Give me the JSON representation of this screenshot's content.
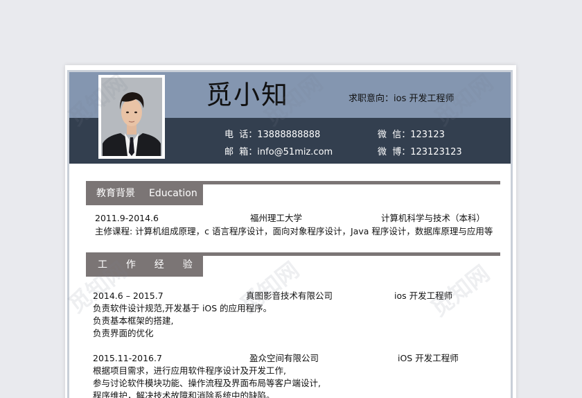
{
  "header": {
    "name": "觅小知",
    "intent_label": "求职意向：",
    "intent_value": "ios 开发工程师"
  },
  "contacts": {
    "phone_label": "电  话：",
    "phone": "13888888888",
    "wechat_label": "微  信：",
    "wechat": "123123",
    "email_label": "邮  箱：",
    "email": "info@51miz.com",
    "weibo_label": "微  博：",
    "weibo": "123123123"
  },
  "education": {
    "title_cn": "教育背景",
    "title_en": "Education",
    "period": "2011.9-2014.6",
    "school": "福州理工大学",
    "major": "计算机科学与技术（本科）",
    "courses": "主修课程: 计算机组成原理，c 语言程序设计，面向对象程序设计，Java 程序设计，数据库原理与应用等"
  },
  "work": {
    "title": "工  作  经  验",
    "jobs": [
      {
        "period": "2014.6  –  2015.7",
        "company": "真图影音技术有限公司",
        "position": "ios 开发工程师",
        "duties": [
          "负责软件设计规范,开发基于 iOS 的应用程序。",
          "负责基本框架的搭建,",
          "负责界面的优化"
        ]
      },
      {
        "period": "2015.11-2016.7",
        "company": "盈众空间有限公司",
        "position": "iOS 开发工程师",
        "duties": [
          "根据项目需求，进行应用软件程序设计及开发工作,",
          "参与讨论软件模块功能、操作流程及界面布局等客户端设计,",
          "程序维护，解决技术故障和消除系统中的缺陷。"
        ]
      }
    ]
  },
  "watermark": "觅知网",
  "colors": {
    "header_top": "#8496b0",
    "header_bottom": "#333f4f",
    "section": "#7b7575",
    "background": "#e9eaee"
  }
}
